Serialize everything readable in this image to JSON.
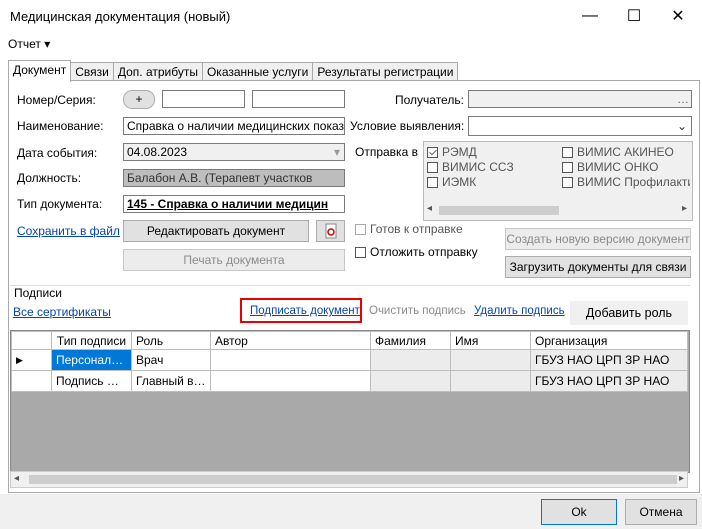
{
  "window": {
    "title": "Медицинская документация (новый)",
    "minimize": "—",
    "maximize": "☐",
    "close": "✕"
  },
  "menu": {
    "report": "Отчет ▾"
  },
  "tabs": [
    "Документ",
    "Связи",
    "Доп. атрибуты",
    "Оказанные услуги",
    "Результаты регистрации"
  ],
  "form": {
    "number_label": "Номер/Серия:",
    "add_symbol": "+",
    "name_label": "Наименование:",
    "name_value": "Справка о наличии медицинских показани",
    "event_date_label": "Дата события:",
    "event_date_value": "04.08.2023",
    "position_label": "Должность:",
    "position_value": "Балабон А.В. (Терапевт участков",
    "doctype_label": "Тип документа:",
    "doctype_value": "145 - Справка о наличии медицин",
    "recipient_label": "Получатель:",
    "condition_label": "Условие выявления:",
    "send_label": "Отправка в",
    "save_file_link": "Сохранить в файл",
    "edit_doc_button": "Редактировать документ",
    "print_doc_button": "Печать документа",
    "ready_label": "Готов к отправке",
    "postpone_label": "Отложить отправку",
    "new_version_button": "Создать новую версию документ",
    "upload_docs_button": "Загрузить документы для связи"
  },
  "send_targets": [
    {
      "label": "РЭМД",
      "checked": true
    },
    {
      "label": "ВИМИС ССЗ",
      "checked": false
    },
    {
      "label": "ИЭМК",
      "checked": false
    },
    {
      "label": "ВИМИС АКИНЕО",
      "checked": false
    },
    {
      "label": "ВИМИС ОНКО",
      "checked": false
    },
    {
      "label": "ВИМИС Профилактик",
      "checked": false
    }
  ],
  "signatures": {
    "section_label": "Подписи",
    "all_certs_link": "Все сертификаты",
    "sign_link": "Подписать документ",
    "clear_link": "Очистить подпись",
    "delete_link": "Удалить подпись",
    "add_role_button": "Добавить роль",
    "columns": [
      "Тип подписи",
      "Роль",
      "Автор",
      "Фамилия",
      "Имя",
      "Организация"
    ],
    "rows": [
      {
        "marker": "▶",
        "type": "Персональн...",
        "role": "Врач",
        "author": "",
        "surname": "",
        "name": "",
        "org": "ГБУЗ НАО ЦРП ЗР НАО"
      },
      {
        "marker": "",
        "type": "Подпись ме...",
        "role": "Главный врач",
        "author": "",
        "surname": "",
        "name": "",
        "org": "ГБУЗ НАО ЦРП ЗР НАО"
      }
    ]
  },
  "footer": {
    "ok": "Ok",
    "cancel": "Отмена"
  }
}
